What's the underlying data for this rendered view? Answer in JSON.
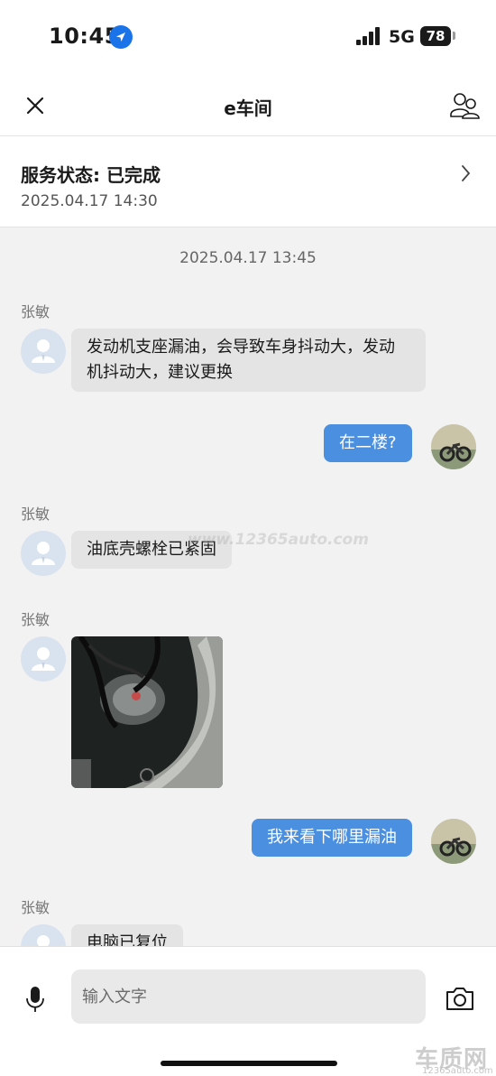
{
  "status_bar": {
    "time": "10:45",
    "network": "5G",
    "battery": "78"
  },
  "header": {
    "title": "e车间",
    "close_icon": "close-icon",
    "contact_icon": "contacts-icon"
  },
  "service": {
    "status": "服务状态: 已完成",
    "time": "2025.04.17 14:30"
  },
  "chat": {
    "timestamp": "2025.04.17 13:45",
    "messages": [
      {
        "sender": "张敏",
        "text": "发动机支座漏油，会导致车身抖动大，发动机抖动大，建议更换",
        "direction": "in"
      },
      {
        "text": "在二楼?",
        "direction": "out"
      },
      {
        "sender": "张敏",
        "text": "油底壳螺栓已紧固",
        "direction": "in"
      },
      {
        "sender": "张敏",
        "type": "image",
        "direction": "in"
      },
      {
        "text": "我来看下哪里漏油",
        "direction": "out"
      },
      {
        "sender": "张敏",
        "text": "电脑已复位",
        "direction": "in"
      }
    ],
    "watermark": "www.12365auto.com"
  },
  "input": {
    "placeholder": "输入文字"
  },
  "watermark": {
    "logo": "车质网",
    "url": "12365auto.com"
  },
  "colors": {
    "accent": "#4a8fe0",
    "incoming_bubble": "#e4e4e4",
    "background": "#f2f2f2"
  }
}
